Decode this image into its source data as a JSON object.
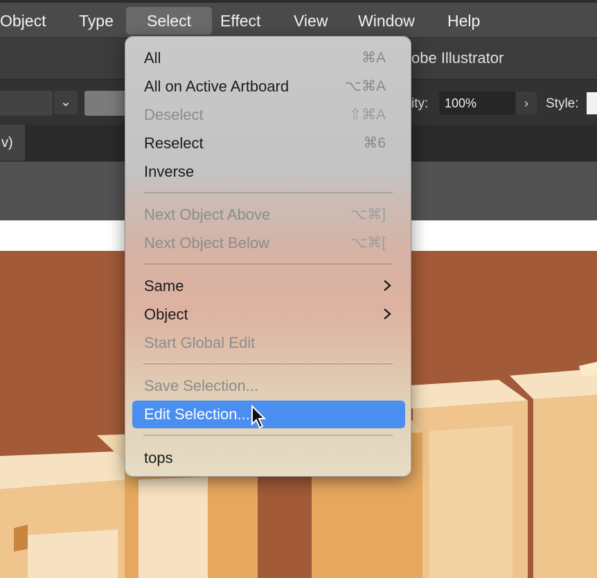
{
  "menubar": {
    "items": [
      "Object",
      "Type",
      "Select",
      "Effect",
      "View",
      "Window",
      "Help"
    ],
    "active": "Select"
  },
  "window": {
    "title_partial": "obe Illustrator"
  },
  "control_bar": {
    "opacity_label_partial": "ity:",
    "opacity_value": "100%",
    "style_label": "Style:"
  },
  "tab": {
    "label_partial": "v)"
  },
  "select_menu": {
    "items": [
      {
        "label": "All",
        "shortcut": "⌘A",
        "enabled": true
      },
      {
        "label": "All on Active Artboard",
        "shortcut": "⌥⌘A",
        "enabled": true
      },
      {
        "label": "Deselect",
        "shortcut": "⇧⌘A",
        "enabled": false
      },
      {
        "label": "Reselect",
        "shortcut": "⌘6",
        "enabled": true
      },
      {
        "label": "Inverse",
        "shortcut": "",
        "enabled": true
      },
      {
        "label": "Next Object Above",
        "shortcut": "⌥⌘]",
        "enabled": false
      },
      {
        "label": "Next Object Below",
        "shortcut": "⌥⌘[",
        "enabled": false
      },
      {
        "label": "Same",
        "submenu": true,
        "enabled": true
      },
      {
        "label": "Object",
        "submenu": true,
        "enabled": true
      },
      {
        "label": "Start Global Edit",
        "shortcut": "",
        "enabled": false
      },
      {
        "label": "Save Selection...",
        "shortcut": "",
        "enabled": false
      },
      {
        "label": "Edit Selection...",
        "shortcut": "",
        "enabled": true,
        "highlighted": true
      },
      {
        "label": "tops",
        "shortcut": "",
        "enabled": true
      }
    ]
  },
  "colors": {
    "highlight": "#4a8ef0",
    "canvas_bg": "#a25a38",
    "letter_light": "#f6e2c1",
    "letter_mid": "#efc48d",
    "letter_dark": "#e6a85e"
  }
}
